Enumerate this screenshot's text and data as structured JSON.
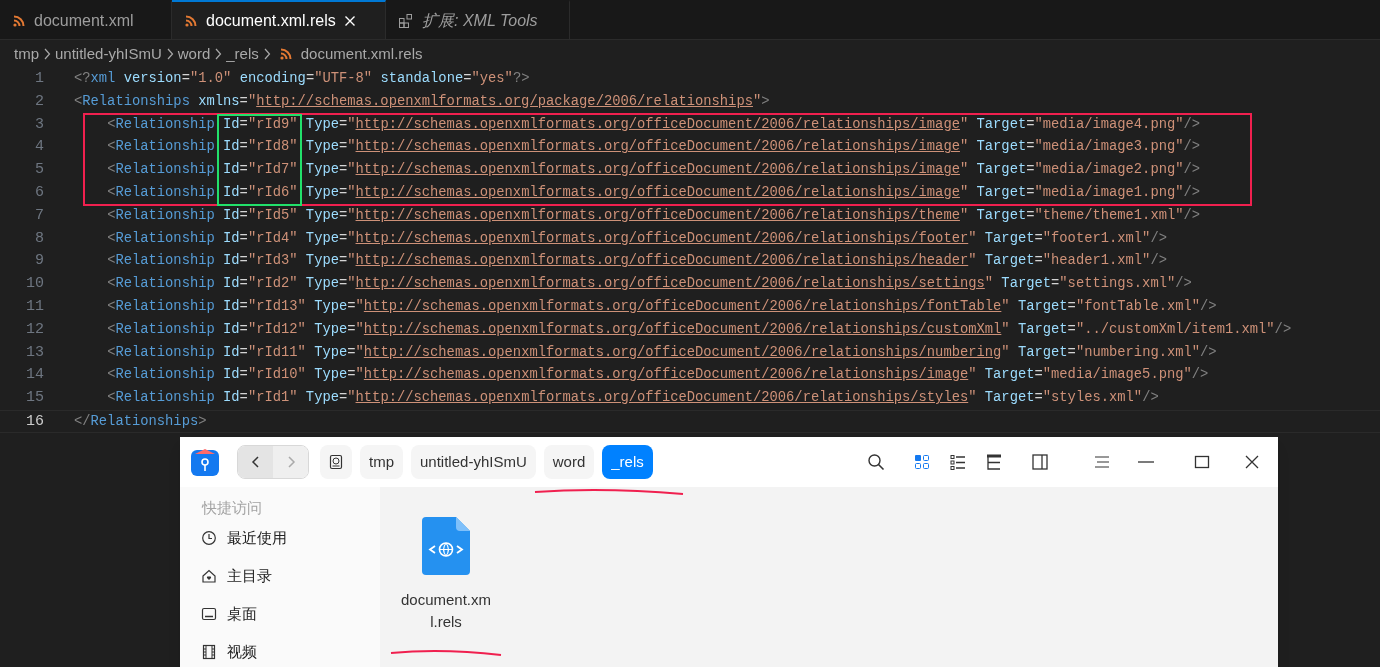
{
  "tabs": [
    {
      "label": "document.xml",
      "kind": "file",
      "selected": false
    },
    {
      "label": "document.xml.rels",
      "kind": "file",
      "selected": true
    },
    {
      "label": "扩展: XML Tools",
      "kind": "extension",
      "selected": false
    }
  ],
  "breadcrumb": [
    "tmp",
    "untitled-yhISmU",
    "word",
    "_rels",
    "document.xml.rels"
  ],
  "annotations": [
    {
      "kind": "box",
      "color": "#f0204f"
    },
    {
      "kind": "id_box",
      "color": "#22e06a"
    },
    {
      "kind": "underline",
      "color": "#f0204f"
    }
  ],
  "lines": [
    {
      "number": "1",
      "text": "<?xml version=\"1.0\" encoding=\"UTF-8\" standalone=\"yes\"?>",
      "boxed": false,
      "current": false
    },
    {
      "number": "2",
      "text": "<Relationships xmlns=\"http://schemas.openxmlformats.org/package/2006/relationships\">",
      "boxed": false,
      "current": false
    },
    {
      "number": "3",
      "text": "    <Relationship Id=\"rId9\" Type=\"http://schemas.openxmlformats.org/officeDocument/2006/relationships/image\" Target=\"media/image4.png\"/>",
      "boxed": true,
      "current": false
    },
    {
      "number": "4",
      "text": "    <Relationship Id=\"rId8\" Type=\"http://schemas.openxmlformats.org/officeDocument/2006/relationships/image\" Target=\"media/image3.png\"/>",
      "boxed": true,
      "current": false
    },
    {
      "number": "5",
      "text": "    <Relationship Id=\"rId7\" Type=\"http://schemas.openxmlformats.org/officeDocument/2006/relationships/image\" Target=\"media/image2.png\"/>",
      "boxed": true,
      "current": false
    },
    {
      "number": "6",
      "text": "    <Relationship Id=\"rId6\" Type=\"http://schemas.openxmlformats.org/officeDocument/2006/relationships/image\" Target=\"media/image1.png\"/>",
      "boxed": true,
      "current": false
    },
    {
      "number": "7",
      "text": "    <Relationship Id=\"rId5\" Type=\"http://schemas.openxmlformats.org/officeDocument/2006/relationships/theme\" Target=\"theme/theme1.xml\"/>",
      "boxed": false,
      "current": false
    },
    {
      "number": "8",
      "text": "    <Relationship Id=\"rId4\" Type=\"http://schemas.openxmlformats.org/officeDocument/2006/relationships/footer\" Target=\"footer1.xml\"/>",
      "boxed": false,
      "current": false
    },
    {
      "number": "9",
      "text": "    <Relationship Id=\"rId3\" Type=\"http://schemas.openxmlformats.org/officeDocument/2006/relationships/header\" Target=\"header1.xml\"/>",
      "boxed": false,
      "current": false
    },
    {
      "number": "10",
      "text": "    <Relationship Id=\"rId2\" Type=\"http://schemas.openxmlformats.org/officeDocument/2006/relationships/settings\" Target=\"settings.xml\"/>",
      "boxed": false,
      "current": false
    },
    {
      "number": "11",
      "text": "    <Relationship Id=\"rId13\" Type=\"http://schemas.openxmlformats.org/officeDocument/2006/relationships/fontTable\" Target=\"fontTable.xml\"/>",
      "boxed": false,
      "current": false
    },
    {
      "number": "12",
      "text": "    <Relationship Id=\"rId12\" Type=\"http://schemas.openxmlformats.org/officeDocument/2006/relationships/customXml\" Target=\"../customXml/item1.xml\"/>",
      "boxed": false,
      "current": false
    },
    {
      "number": "13",
      "text": "    <Relationship Id=\"rId11\" Type=\"http://schemas.openxmlformats.org/officeDocument/2006/relationships/numbering\" Target=\"numbering.xml\"/>",
      "boxed": false,
      "current": false
    },
    {
      "number": "14",
      "text": "    <Relationship Id=\"rId10\" Type=\"http://schemas.openxmlformats.org/officeDocument/2006/relationships/image\" Target=\"media/image5.png\"/>",
      "boxed": false,
      "current": false
    },
    {
      "number": "15",
      "text": "    <Relationship Id=\"rId1\" Type=\"http://schemas.openxmlformats.org/officeDocument/2006/relationships/styles\" Target=\"styles.xml\"/>",
      "boxed": false,
      "current": false
    },
    {
      "number": "16",
      "text": "</Relationships>",
      "boxed": false,
      "current": true
    }
  ],
  "file_manager": {
    "path": [
      {
        "label": "tmp",
        "selected": false,
        "underlined": false
      },
      {
        "label": "untitled-yhISmU",
        "selected": false,
        "underlined": false
      },
      {
        "label": "word",
        "selected": false,
        "underlined": true
      },
      {
        "label": "_rels",
        "selected": true,
        "underlined": true
      }
    ],
    "views": [
      {
        "kind": "icons",
        "selected": true
      },
      {
        "kind": "list",
        "selected": false
      },
      {
        "kind": "tree",
        "selected": false
      }
    ],
    "sidebar": {
      "heading": "快捷访问",
      "items": [
        {
          "label": "最近使用",
          "kind": "recent"
        },
        {
          "label": "主目录",
          "kind": "home"
        },
        {
          "label": "桌面",
          "kind": "desktop"
        },
        {
          "label": "视频",
          "kind": "videos"
        }
      ]
    },
    "files": [
      {
        "name": "document.xml.rels",
        "underlined": true
      }
    ]
  }
}
